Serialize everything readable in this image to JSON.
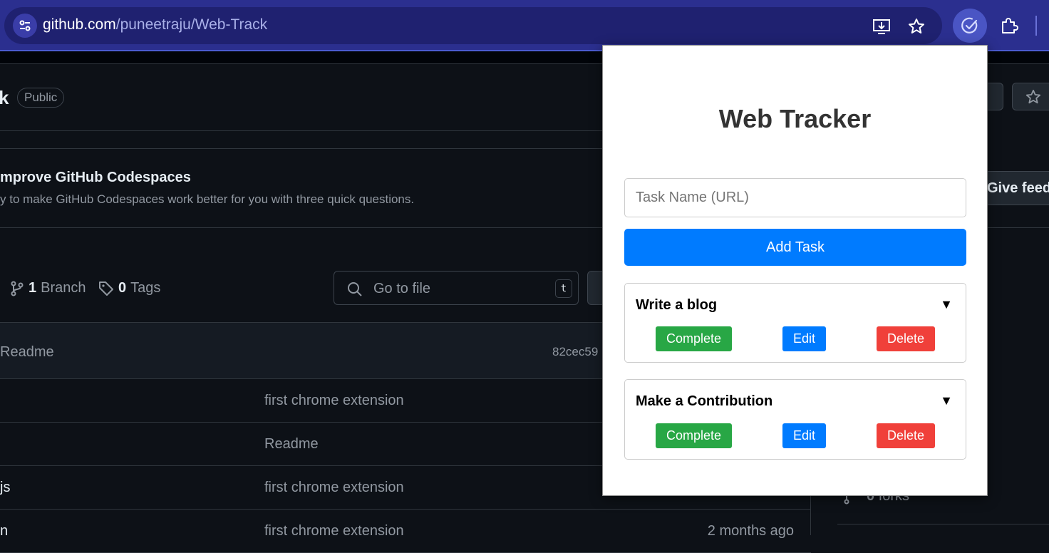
{
  "browser": {
    "url_host": "github.com",
    "url_path": "/puneetraju/Web-Track",
    "icons": [
      "site-info-icon",
      "install-app-icon",
      "bookmark-star-icon",
      "web-tracker-extension-icon",
      "extensions-puzzle-icon"
    ]
  },
  "github": {
    "repo_name_tail": "k",
    "visibility_badge": "Public",
    "survey_title": "mprove GitHub Codespaces",
    "survey_subtitle": "y to make GitHub Codespaces work better for you with three quick questions.",
    "feedback_button": "Give feedl",
    "branch_count": "1",
    "branch_label": "Branch",
    "tags_count": "0",
    "tags_label": "Tags",
    "go_to_file_placeholder": "Go to file",
    "go_to_file_shortcut": "t",
    "latest_commit_message": "Readme",
    "latest_commit_hash": "82cec59",
    "files": [
      {
        "name": "",
        "message": "first chrome extension",
        "age": ""
      },
      {
        "name": "",
        "message": "Readme",
        "age": ""
      },
      {
        "name": "js",
        "message": "first chrome extension",
        "age": ""
      },
      {
        "name": "n",
        "message": "first chrome extension",
        "age": "2 months ago"
      }
    ],
    "forks_count": "0",
    "forks_label": "forks"
  },
  "popup": {
    "title": "Web Tracker",
    "task_input_placeholder": "Task Name (URL)",
    "add_button": "Add Task",
    "tasks": [
      {
        "name": "Write a blog",
        "caret": "▼",
        "complete": "Complete",
        "edit": "Edit",
        "delete": "Delete"
      },
      {
        "name": "Make a Contribution",
        "caret": "▼",
        "complete": "Complete",
        "edit": "Edit",
        "delete": "Delete"
      }
    ]
  },
  "colors": {
    "primary": "#007bff",
    "complete": "#28a745",
    "delete": "#f0403a",
    "github_bg": "#0d1117",
    "chrome_bg": "#2b2f8f"
  }
}
